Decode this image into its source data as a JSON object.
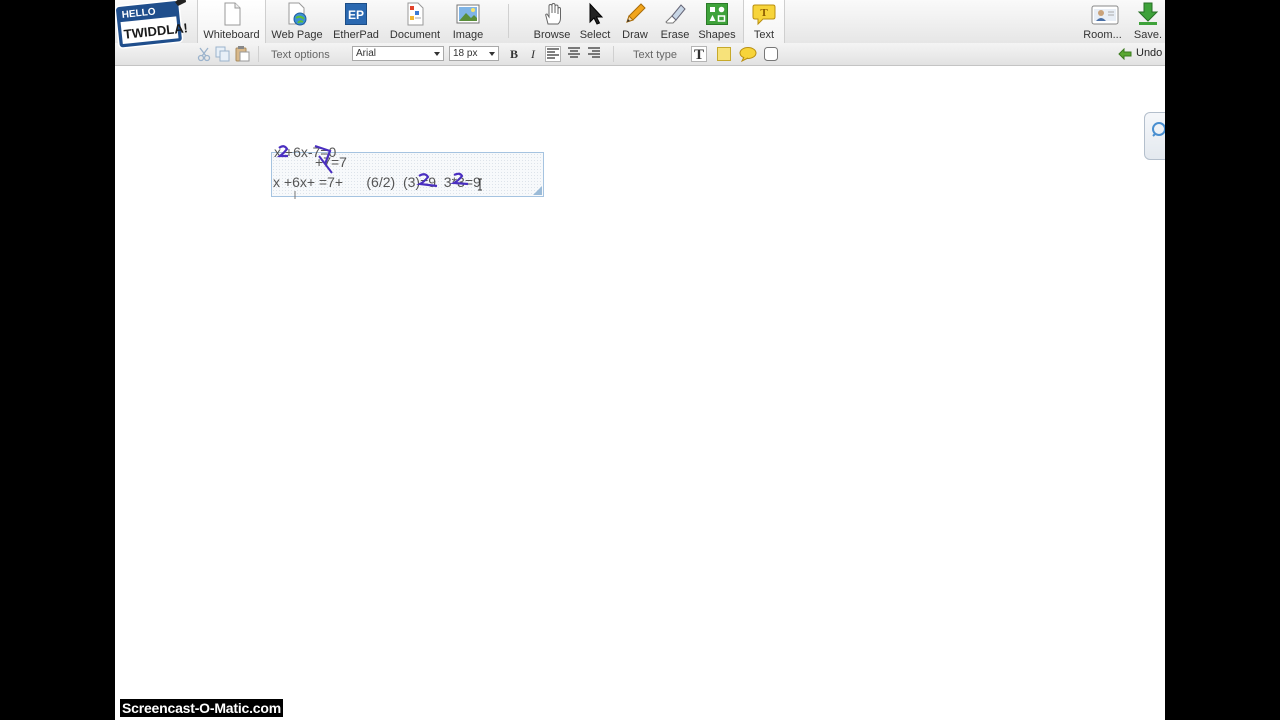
{
  "brand": {
    "logo_line1": "HELLO",
    "logo_line2": "TWIDDLA!"
  },
  "toolbar": {
    "left_tools": [
      {
        "label": "Whiteboard",
        "icon": "page-icon"
      },
      {
        "label": "Web Page",
        "icon": "globe-page-icon"
      },
      {
        "label": "EtherPad",
        "icon": "etherpad-icon"
      },
      {
        "label": "Document",
        "icon": "document-icon"
      },
      {
        "label": "Image",
        "icon": "image-icon"
      }
    ],
    "right_tools": [
      {
        "label": "Browse",
        "icon": "hand-icon"
      },
      {
        "label": "Select",
        "icon": "arrow-cursor-icon"
      },
      {
        "label": "Draw",
        "icon": "pencil-icon"
      },
      {
        "label": "Erase",
        "icon": "eraser-icon"
      },
      {
        "label": "Shapes",
        "icon": "shapes-icon"
      },
      {
        "label": "Text",
        "icon": "text-bubble-icon"
      }
    ],
    "room_label": "Room...",
    "save_label": "Save.",
    "etherpad_icon_text": "EP",
    "text_icon_glyph": "T"
  },
  "subbar": {
    "text_options_label": "Text options",
    "font_family": "Arial",
    "font_size": "18 px",
    "bold_glyph": "B",
    "italic_glyph": "I",
    "text_type_label": "Text type",
    "text_type_glyph": "T",
    "undo_label": "Undo"
  },
  "canvas": {
    "line1": "x +6x-7=0",
    "line2": "+7=7",
    "line3": "x +6x+ =7+      (6/2)  (3)=9  3*3=9"
  },
  "overlay": {
    "watermark": "Screencast-O-Matic.com"
  },
  "colors": {
    "ink": "#4a2fc0",
    "selection_border": "#a5c3e0",
    "active_tool_bg": "#ffffff"
  }
}
